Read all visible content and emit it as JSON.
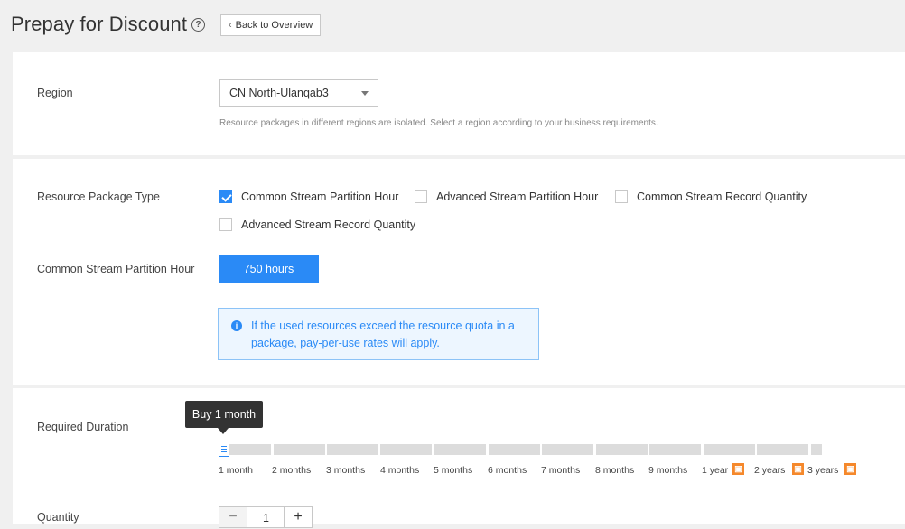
{
  "header": {
    "title": "Prepay for Discount",
    "help_icon": "question-circle-icon",
    "back_label": "Back to Overview"
  },
  "region": {
    "label": "Region",
    "selected": "CN North-Ulanqab3",
    "hint": "Resource packages in different regions are isolated. Select a region according to your business requirements."
  },
  "package": {
    "label": "Resource Package Type",
    "options": [
      {
        "label": "Common Stream Partition Hour",
        "checked": true
      },
      {
        "label": "Advanced Stream Partition Hour",
        "checked": false
      },
      {
        "label": "Common Stream Record Quantity",
        "checked": false
      },
      {
        "label": "Advanced Stream Record Quantity",
        "checked": false
      }
    ]
  },
  "partition": {
    "label": "Common Stream Partition Hour",
    "selected_option": "750 hours"
  },
  "notice": {
    "text": "If the used resources exceed the resource quota in a package, pay-per-use rates will apply."
  },
  "duration": {
    "label": "Required Duration",
    "tooltip": "Buy 1 month",
    "ticks": [
      "1 month",
      "2 months",
      "3 months",
      "4 months",
      "5 months",
      "6 months",
      "7 months",
      "8 months",
      "9 months",
      "1 year",
      "2 years",
      "3 years"
    ],
    "discount_badge_icon": "gift-icon",
    "selected_index": 0
  },
  "quantity": {
    "label": "Quantity",
    "value": "1",
    "minus": "−",
    "plus": "+"
  },
  "colors": {
    "accent": "#2a8af6",
    "badge": "#f5882b",
    "tooltip_bg": "#333333"
  }
}
